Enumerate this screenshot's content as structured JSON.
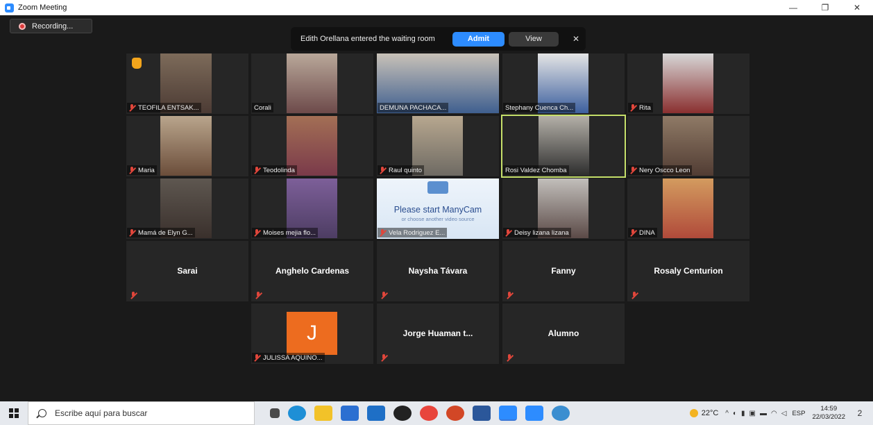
{
  "window": {
    "title": "Zoom Meeting",
    "controls": {
      "minimize": "—",
      "restore": "❐",
      "close": "✕"
    }
  },
  "recording": {
    "label": "Recording..."
  },
  "notification": {
    "message": "Edith Orellana entered the waiting room",
    "admit_label": "Admit",
    "view_label": "View",
    "close_glyph": "✕"
  },
  "participants": [
    {
      "name": "TEOFILA ENTSAK...",
      "video": true,
      "hand_raised": true,
      "muted": true
    },
    {
      "name": "Corali",
      "video": true,
      "muted": false
    },
    {
      "name": "DEMUNA PACHACA...",
      "video": true,
      "muted": false
    },
    {
      "name": "Stephany Cuenca Ch...",
      "video": true,
      "muted": false
    },
    {
      "name": "Rita",
      "video": true,
      "muted": true
    },
    {
      "name": "Maria",
      "video": true,
      "muted": true
    },
    {
      "name": "Teodolinda",
      "video": true,
      "muted": true
    },
    {
      "name": "Raul quinto",
      "video": true,
      "muted": true
    },
    {
      "name": "Rosi Valdez Chomba",
      "video": true,
      "muted": false,
      "active_speaker": true
    },
    {
      "name": "Nery Oscco Leon",
      "video": true,
      "muted": true
    },
    {
      "name": "Mamá de Elyn G...",
      "video": true,
      "muted": true
    },
    {
      "name": "Moises mejia flo...",
      "video": true,
      "muted": true
    },
    {
      "name": "Vela Rodriguez E...",
      "video": true,
      "muted": true,
      "manycam": {
        "line1": "Please start ManyCam",
        "line2": "or choose another video source"
      }
    },
    {
      "name": "Deisy lizana lizana",
      "video": true,
      "muted": true
    },
    {
      "name": "DINA",
      "video": true,
      "muted": true
    },
    {
      "name": "Sarai",
      "video": false,
      "muted": true
    },
    {
      "name": "Anghelo Cardenas",
      "video": false,
      "muted": true
    },
    {
      "name": "Naysha Távara",
      "video": false,
      "muted": true
    },
    {
      "name": "Fanny",
      "video": false,
      "muted": true
    },
    {
      "name": "Rosaly Centurion",
      "video": false,
      "muted": true
    },
    {
      "name": "JULISSA AQUINO...",
      "video": false,
      "avatar_letter": "J",
      "muted": true
    },
    {
      "name": "Jorge Huaman t...",
      "video": false,
      "muted": true
    },
    {
      "name": "Alumno",
      "video": false,
      "muted": true
    }
  ],
  "taskbar": {
    "search_placeholder": "Escribe aquí para buscar",
    "temperature": "22°C",
    "language": "ESP",
    "time": "14:59",
    "date": "22/03/2022",
    "notification_count": "2"
  },
  "colors": {
    "accent": "#2d8cff",
    "active_speaker_border": "#c6e06a",
    "muted_icon": "#e0463b",
    "avatar_bg": "#ed6c1f"
  }
}
